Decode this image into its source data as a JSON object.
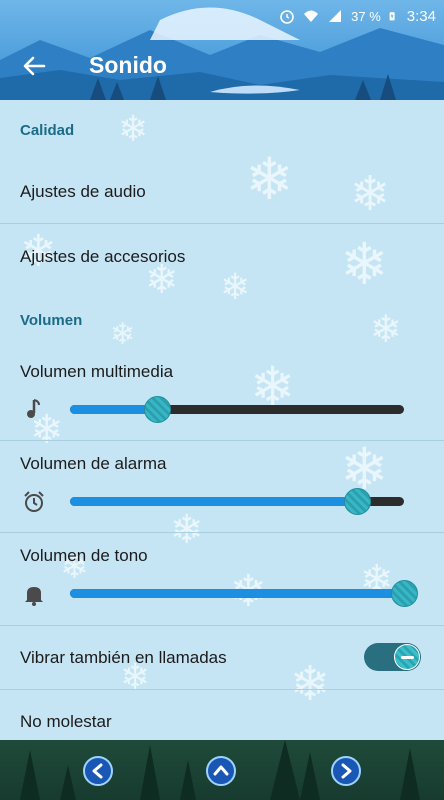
{
  "status_bar": {
    "battery_percent": "37 %",
    "time": "3:34",
    "icons": [
      "alarm-icon",
      "wifi-icon",
      "signal-icon",
      "battery-icon"
    ]
  },
  "header": {
    "title": "Sonido",
    "back_icon": "arrow-left-icon"
  },
  "sections": {
    "quality": {
      "header": "Calidad",
      "items": [
        "Ajustes de audio",
        "Ajustes de accesorios"
      ]
    },
    "volume": {
      "header": "Volumen",
      "sliders": [
        {
          "label": "Volumen multimedia",
          "icon": "music-note-icon",
          "level": 0.26
        },
        {
          "label": "Volumen de alarma",
          "icon": "alarm-clock-icon",
          "level": 0.86
        },
        {
          "label": "Volumen de tono",
          "icon": "bell-icon",
          "level": 1.0
        }
      ]
    }
  },
  "vibrate": {
    "label": "Vibrar también en llamadas",
    "enabled": true
  },
  "do_not_disturb": {
    "label": "No molestar"
  },
  "bottom_nav": {
    "icons": [
      "nav-back-icon",
      "nav-home-icon",
      "nav-recents-icon"
    ]
  },
  "colors": {
    "accent": "#1c8fe0",
    "section_header": "#1b6b86",
    "header_bg": "#4f9fdc",
    "content_bg": "#c6e5f4"
  }
}
